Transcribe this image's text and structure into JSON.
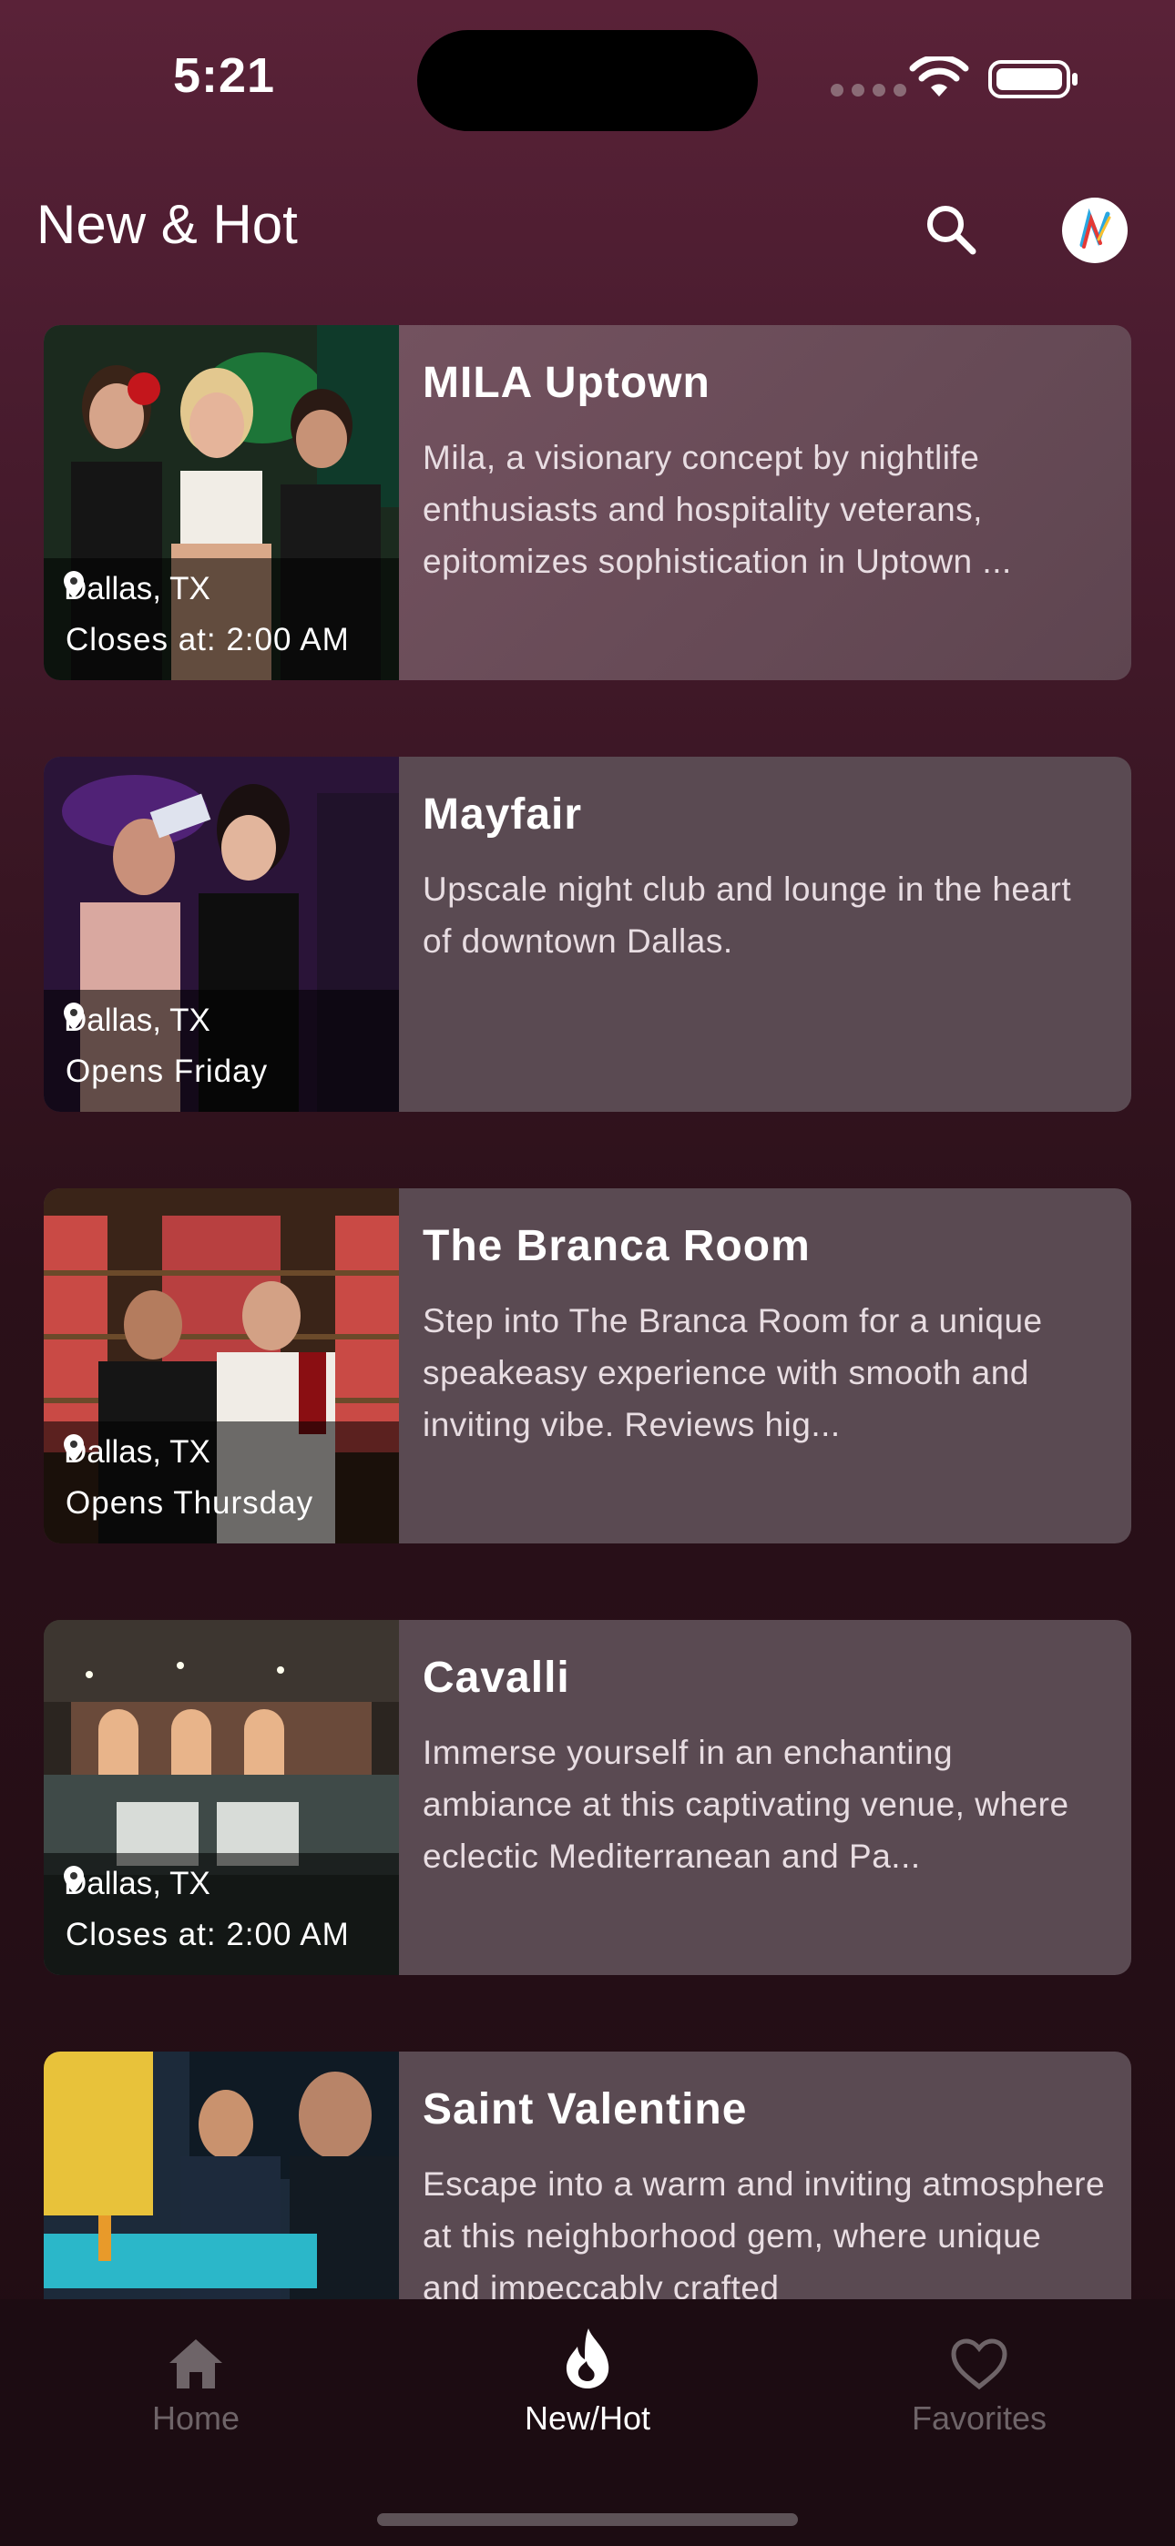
{
  "status": {
    "time": "5:21"
  },
  "header": {
    "title": "New & Hot"
  },
  "venues": [
    {
      "name": "MILA Uptown",
      "location": "Dallas, TX",
      "hours": "Closes at: 2:00 AM",
      "description": "Mila, a visionary concept by nightlife enthusiasts and hospitality veterans, epitomizes sophistication in Uptown ..."
    },
    {
      "name": "Mayfair",
      "location": "Dallas, TX",
      "hours": "Opens Friday",
      "description": "Upscale night club and lounge in the heart of downtown Dallas."
    },
    {
      "name": "The Branca Room",
      "location": "Dallas, TX",
      "hours": "Opens Thursday",
      "description": "Step into The Branca Room for a unique speakeasy experience with smooth and inviting vibe. Reviews hig..."
    },
    {
      "name": "Cavalli",
      "location": "Dallas, TX",
      "hours": "Closes at: 2:00 AM",
      "description": "Immerse yourself in an enchanting ambiance at this captivating venue, where eclectic Mediterranean and Pa..."
    },
    {
      "name": "Saint Valentine",
      "location": "",
      "hours": "",
      "description": "Escape into a warm and inviting atmosphere at this neighborhood gem, where unique and impeccably crafted"
    }
  ],
  "tabs": [
    {
      "label": "Home",
      "icon": "home-icon"
    },
    {
      "label": "New/Hot",
      "icon": "flame-icon"
    },
    {
      "label": "Favorites",
      "icon": "heart-icon"
    }
  ],
  "colors": {
    "accent": "#ffffff",
    "inactive": "#6e6468",
    "background": "#4a1c2f"
  }
}
